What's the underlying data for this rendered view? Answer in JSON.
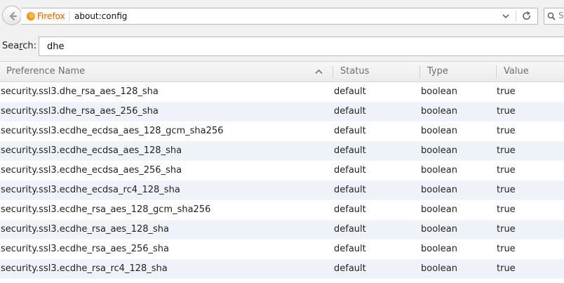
{
  "toolbar": {
    "identity_label": "Firefox",
    "url": "about:config",
    "search_placeholder": "S"
  },
  "filter": {
    "label_prefix": "Sea",
    "label_underlined": "r",
    "label_suffix": "ch:",
    "value": "dhe"
  },
  "columns": [
    "Preference Name",
    "Status",
    "Type",
    "Value"
  ],
  "rows": [
    {
      "name": "security.ssl3.dhe_rsa_aes_128_sha",
      "status": "default",
      "type": "boolean",
      "value": "true"
    },
    {
      "name": "security.ssl3.dhe_rsa_aes_256_sha",
      "status": "default",
      "type": "boolean",
      "value": "true"
    },
    {
      "name": "security.ssl3.ecdhe_ecdsa_aes_128_gcm_sha256",
      "status": "default",
      "type": "boolean",
      "value": "true"
    },
    {
      "name": "security.ssl3.ecdhe_ecdsa_aes_128_sha",
      "status": "default",
      "type": "boolean",
      "value": "true"
    },
    {
      "name": "security.ssl3.ecdhe_ecdsa_aes_256_sha",
      "status": "default",
      "type": "boolean",
      "value": "true"
    },
    {
      "name": "security.ssl3.ecdhe_ecdsa_rc4_128_sha",
      "status": "default",
      "type": "boolean",
      "value": "true"
    },
    {
      "name": "security.ssl3.ecdhe_rsa_aes_128_gcm_sha256",
      "status": "default",
      "type": "boolean",
      "value": "true"
    },
    {
      "name": "security.ssl3.ecdhe_rsa_aes_128_sha",
      "status": "default",
      "type": "boolean",
      "value": "true"
    },
    {
      "name": "security.ssl3.ecdhe_rsa_aes_256_sha",
      "status": "default",
      "type": "boolean",
      "value": "true"
    },
    {
      "name": "security.ssl3.ecdhe_rsa_rc4_128_sha",
      "status": "default",
      "type": "boolean",
      "value": "true"
    }
  ],
  "colors": {
    "identity": "#e66000",
    "alt_row": "#eef3fa",
    "header_text": "#6d6d6d"
  }
}
